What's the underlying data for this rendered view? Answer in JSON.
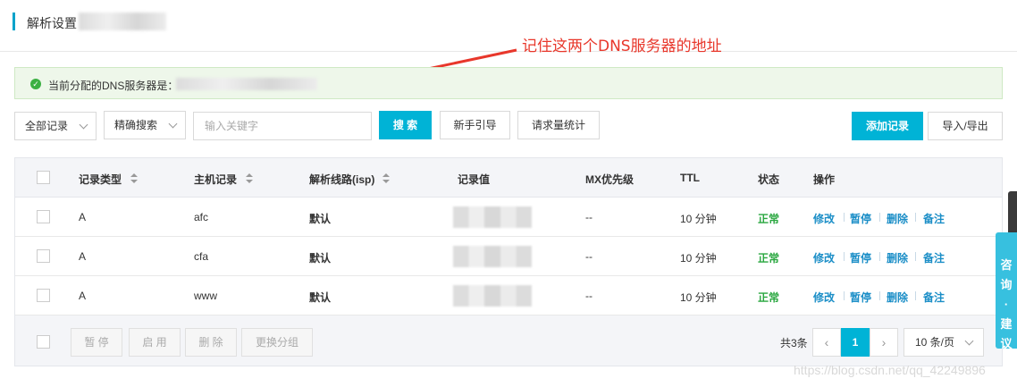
{
  "header": {
    "title": "解析设置"
  },
  "annotation": {
    "text": "记住这两个DNS服务器的地址",
    "color": "#e8372b"
  },
  "notice": {
    "text": "当前分配的DNS服务器是：",
    "icon": "check-circle-icon"
  },
  "toolbar": {
    "record_filter": "全部记录",
    "search_mode": "精确搜索",
    "keyword_placeholder": "输入关键字",
    "search_label": "搜 索",
    "guide_label": "新手引导",
    "stats_label": "请求量统计",
    "add_label": "添加记录",
    "import_export_label": "导入/导出"
  },
  "table": {
    "columns": [
      "记录类型",
      "主机记录",
      "解析线路(isp)",
      "记录值",
      "MX优先级",
      "TTL",
      "状态",
      "操作"
    ],
    "rows": [
      {
        "type": "A",
        "host": "afc",
        "line": "默认",
        "mx": "--",
        "ttl": "10 分钟",
        "status": "正常"
      },
      {
        "type": "A",
        "host": "cfa",
        "line": "默认",
        "mx": "--",
        "ttl": "10 分钟",
        "status": "正常"
      },
      {
        "type": "A",
        "host": "www",
        "line": "默认",
        "mx": "--",
        "ttl": "10 分钟",
        "status": "正常"
      }
    ],
    "actions": {
      "edit": "修改",
      "pause": "暂停",
      "delete": "删除",
      "note": "备注"
    }
  },
  "footer": {
    "pause_label": "暂 停",
    "enable_label": "启 用",
    "delete_label": "删 除",
    "change_group_label": "更换分组",
    "total": "共3条",
    "current_page": "1",
    "page_size": "10 条/页"
  },
  "side": {
    "feedback": "咨询·建议"
  },
  "watermark": "https://blog.csdn.net/qq_42249896",
  "colors": {
    "accent": "#00b3d6",
    "status_ok": "#2aa740",
    "link": "#1b8ec7"
  }
}
